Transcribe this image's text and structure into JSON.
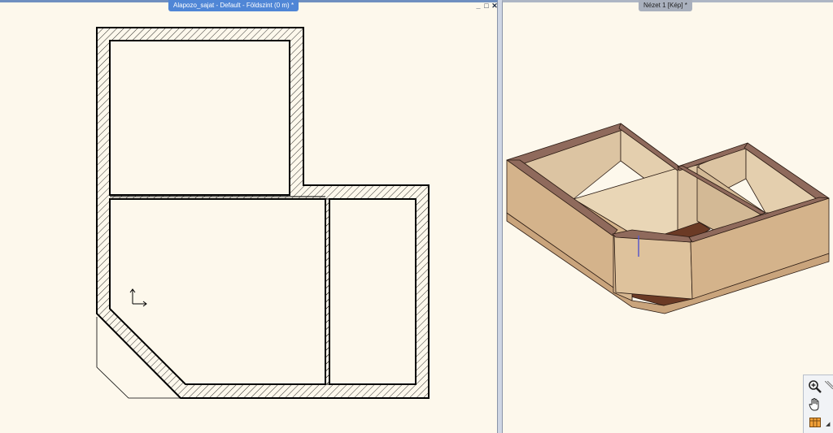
{
  "left_view": {
    "title": "Alapozo_sajat - Default - Földszint (0 m) *"
  },
  "right_view": {
    "title": "Nézet 1 [Kép] *"
  },
  "window_controls": {
    "minimize": "_",
    "restore": "□",
    "close": "✕"
  },
  "tools": [
    {
      "name": "zoom-tool",
      "icon": "magnifier-plus-icon"
    },
    {
      "name": "pan-tool",
      "icon": "hand-icon"
    },
    {
      "name": "display-tool",
      "icon": "layers-icon"
    }
  ],
  "colors": {
    "canvas": "#fdf8ec",
    "wall_outline": "#000000",
    "wall_top": "#8f6a5c",
    "wall_inner": "#dcc4a2",
    "wall_outer": "#c9a47c",
    "floor": "#6b3a25",
    "active_tab": "#4f86d6",
    "inactive_tab": "#a9b0bd"
  }
}
